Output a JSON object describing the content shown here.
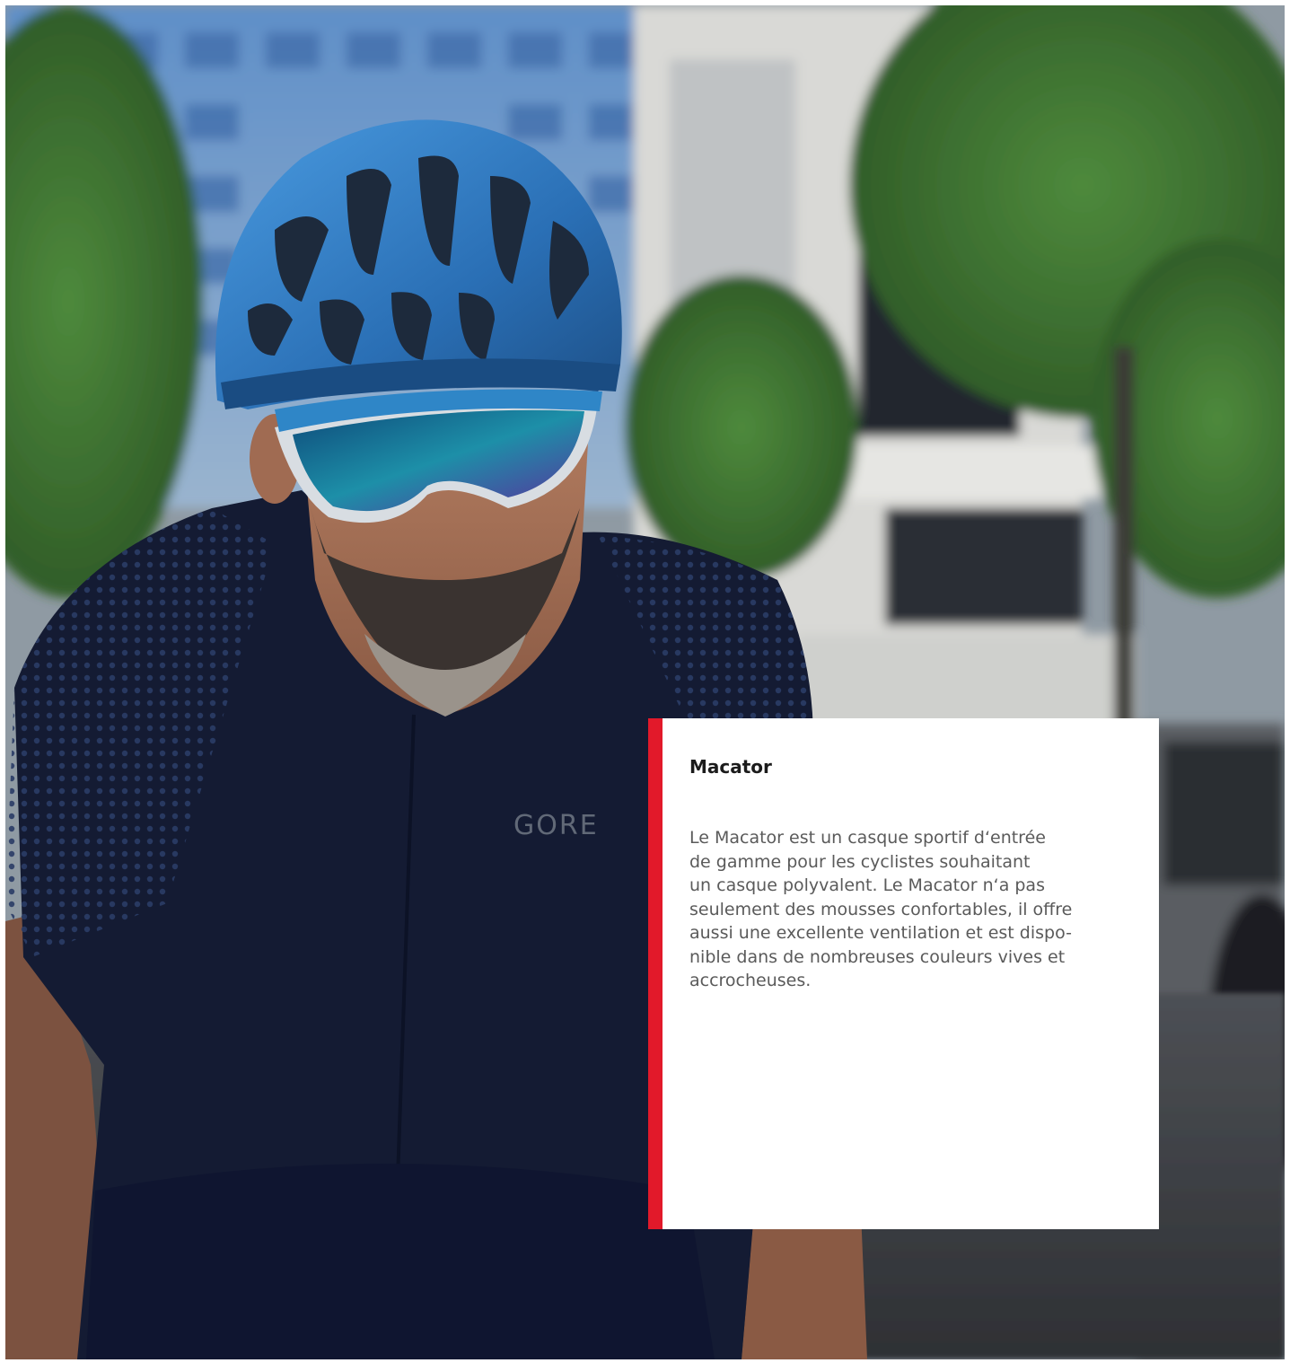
{
  "scene": {
    "jersey_logo": "GORE"
  },
  "card": {
    "title": "Macator",
    "body": "Le Macator est un casque sportif d‘entrée\nde gamme pour les cyclistes souhaitant\nun casque polyvalent. Le Macator n‘a pas\nseulement des mousses confortables, il offre\naussi une excellente ventilation et est dispo-\nnible dans de nombreuses couleurs vives et\naccrocheuses."
  },
  "colors": {
    "accent": "#e2192a",
    "card_background": "#ffffff",
    "helmet": "#2f7fc4",
    "jersey": "#141b33"
  }
}
